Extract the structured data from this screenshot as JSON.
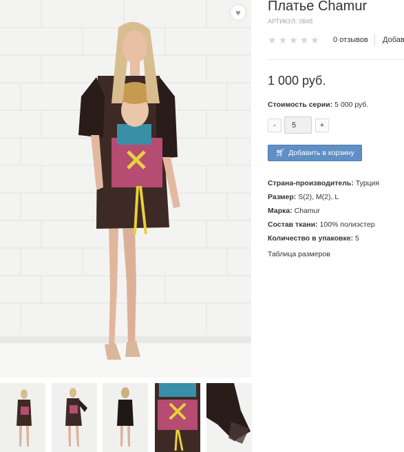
{
  "product": {
    "title": "Платье Chamur",
    "sku_label": "АРТИКУЛ:",
    "sku_value": "0848",
    "favorite_icon": "heart-icon",
    "rating": {
      "stars": 0,
      "max": 5,
      "star_glyph": "★"
    },
    "reviews_label": "0 отзывов",
    "add_review_label": "Добавить отзыв",
    "price": "1 000 руб.",
    "series_price_label": "Стоимость серии:",
    "series_price_value": "5 000 руб.",
    "quantity": {
      "minus_label": "-",
      "plus_label": "+",
      "value": "5"
    },
    "add_to_cart": {
      "icon": "shopping-cart-icon",
      "label": "Добавить в корзину"
    },
    "properties": [
      {
        "key": "Страна-производитель:",
        "value": "Турция"
      },
      {
        "key": "Размер:",
        "value": "S(2), M(2), L"
      },
      {
        "key": "Марка:",
        "value": "Chamur"
      },
      {
        "key": "Состав ткани:",
        "value": "100% полиэстер"
      },
      {
        "key": "Количество в упаковке:",
        "value": "5"
      }
    ],
    "size_table_link": "Таблица размеров"
  },
  "gallery": {
    "main_image": "photo-model-in-printed-dress",
    "thumbnails": [
      "thumb-front-full",
      "thumb-front-pose",
      "thumb-back",
      "thumb-print-detail",
      "thumb-sleeve-detail"
    ]
  },
  "colors": {
    "accent_button": "#5f8fc4",
    "dress": "#3e2a25",
    "wall": "#f1f1f0"
  }
}
